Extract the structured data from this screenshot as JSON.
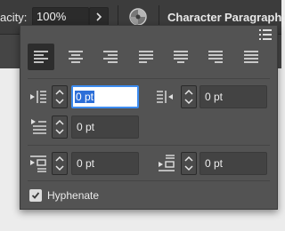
{
  "topbar": {
    "opacity_label": "acity:",
    "opacity_value": "100%",
    "character_label": "Character",
    "paragraph_label": "Paragraph:"
  },
  "paragraph_panel": {
    "alignment_buttons": [
      {
        "icon": "align-left-icon",
        "selected": true
      },
      {
        "icon": "align-center-icon",
        "selected": false
      },
      {
        "icon": "align-right-icon",
        "selected": false
      },
      {
        "icon": "justify-last-left-icon",
        "selected": false
      },
      {
        "icon": "justify-last-center-icon",
        "selected": false
      },
      {
        "icon": "justify-last-right-icon",
        "selected": false
      },
      {
        "icon": "justify-all-icon",
        "selected": false
      }
    ],
    "left_indent": "0 pt",
    "right_indent": "0 pt",
    "first_line_indent": "0 pt",
    "space_before": "0 pt",
    "space_after": "0 pt",
    "hyphenate_label": "Hyphenate",
    "hyphenate_checked": true
  }
}
